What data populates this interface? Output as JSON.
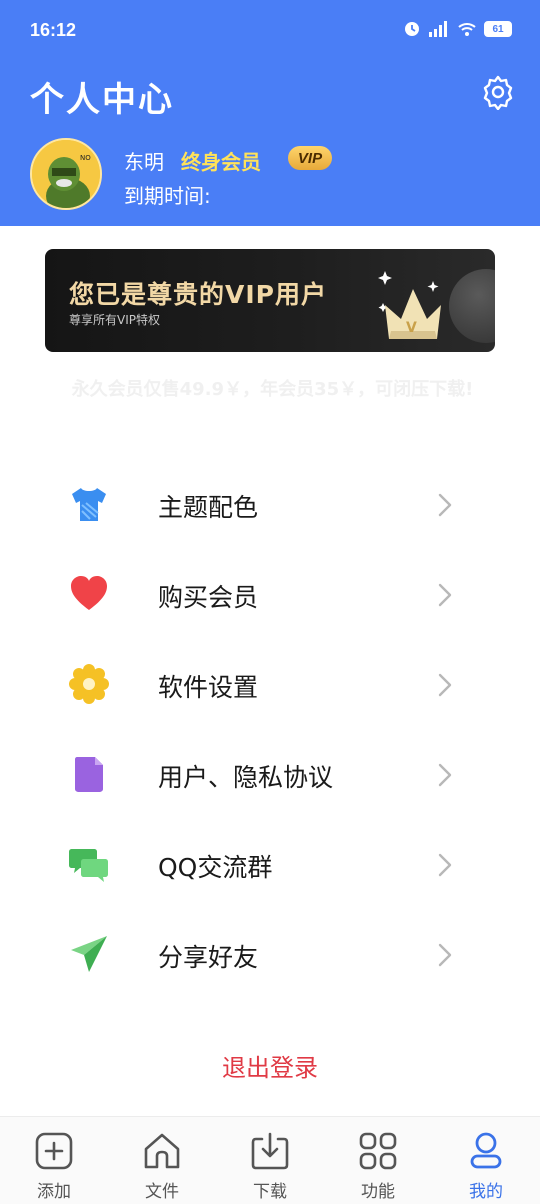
{
  "status_bar": {
    "time": "16:12",
    "battery": "61"
  },
  "header": {
    "title": "个人中心",
    "user_name": "东明",
    "member_level": "终身会员",
    "vip_badge": "VIP",
    "expire_label": "到期时间:"
  },
  "vip_banner": {
    "title": "您已是尊贵的VIP用户",
    "subtitle": "尊享所有VIP特权",
    "crown_letter": "V"
  },
  "promo": {
    "text": "永久会员仅售49.9￥，年会员35￥，可闭压下载!"
  },
  "menu": [
    {
      "label": "主题配色",
      "icon": "shirt-icon"
    },
    {
      "label": "购买会员",
      "icon": "heart-icon"
    },
    {
      "label": "软件设置",
      "icon": "gear-flower-icon"
    },
    {
      "label": "用户、隐私协议",
      "icon": "document-icon"
    },
    {
      "label": "QQ交流群",
      "icon": "chat-bubbles-icon"
    },
    {
      "label": "分享好友",
      "icon": "paper-plane-icon"
    }
  ],
  "logout_label": "退出登录",
  "bottom_nav": [
    {
      "label": "添加",
      "icon": "add-square-icon"
    },
    {
      "label": "文件",
      "icon": "home-icon"
    },
    {
      "label": "下载",
      "icon": "download-icon"
    },
    {
      "label": "功能",
      "icon": "grid-icon"
    },
    {
      "label": "我的",
      "icon": "user-icon",
      "active": true
    }
  ],
  "colors": {
    "header_bg": "#4a7ef6",
    "member_gold": "#ffe25a",
    "logout_red": "#e03a45",
    "active_nav": "#3a72e8"
  }
}
